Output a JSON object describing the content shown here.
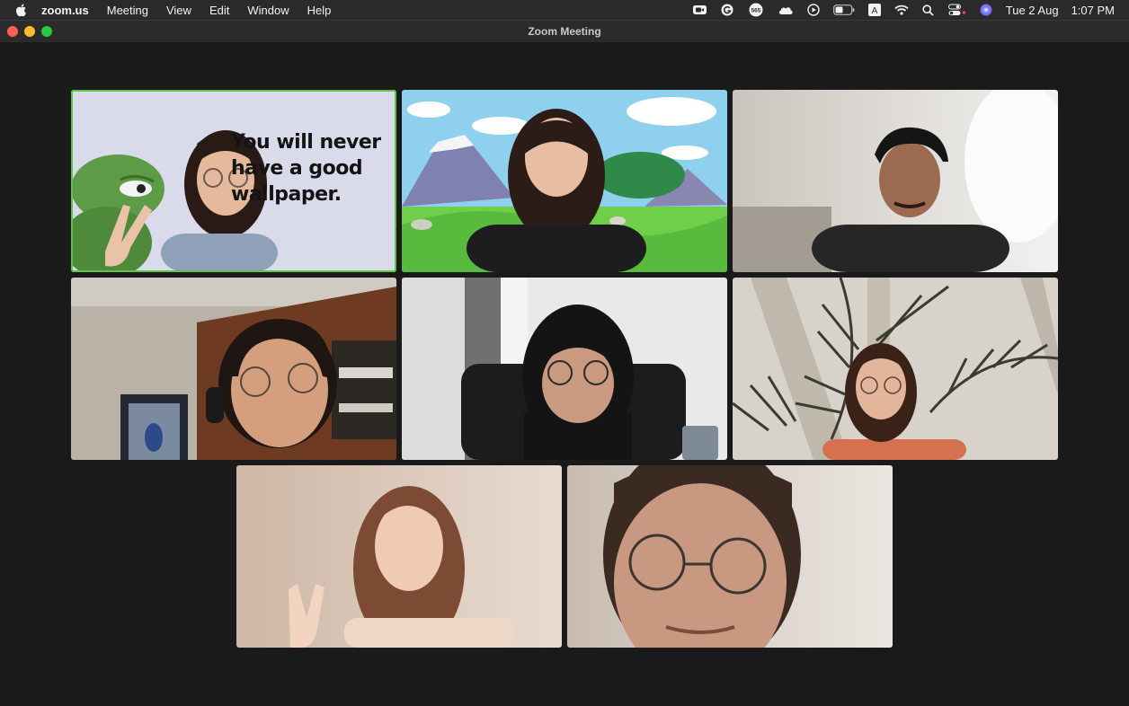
{
  "menubar": {
    "app_name": "zoom.us",
    "menus": [
      "Meeting",
      "View",
      "Edit",
      "Window",
      "Help"
    ],
    "status_icons": [
      "camera-icon",
      "grammarly-icon",
      "badge-icon",
      "cloud-icon",
      "play-icon",
      "battery-icon",
      "keyboard-input-icon",
      "wifi-icon",
      "search-icon",
      "control-center-icon",
      "siri-icon"
    ],
    "badge_count": "565",
    "input_source": "A",
    "date": "Tue 2 Aug",
    "time": "1:07 PM"
  },
  "window": {
    "title": "Zoom Meeting"
  },
  "gallery": {
    "tiles": [
      {
        "id": "participant-1",
        "active_speaker": true,
        "background_text": "You will never\nhave a good\nwallpaper."
      },
      {
        "id": "participant-2",
        "active_speaker": false
      },
      {
        "id": "participant-3",
        "active_speaker": false
      },
      {
        "id": "participant-4",
        "active_speaker": false
      },
      {
        "id": "participant-5",
        "active_speaker": false
      },
      {
        "id": "participant-6",
        "active_speaker": false
      },
      {
        "id": "participant-7",
        "active_speaker": false
      },
      {
        "id": "participant-8",
        "active_speaker": false
      }
    ]
  },
  "colors": {
    "active_speaker_border": "#5fc34a",
    "window_background": "#1a1a1a"
  }
}
